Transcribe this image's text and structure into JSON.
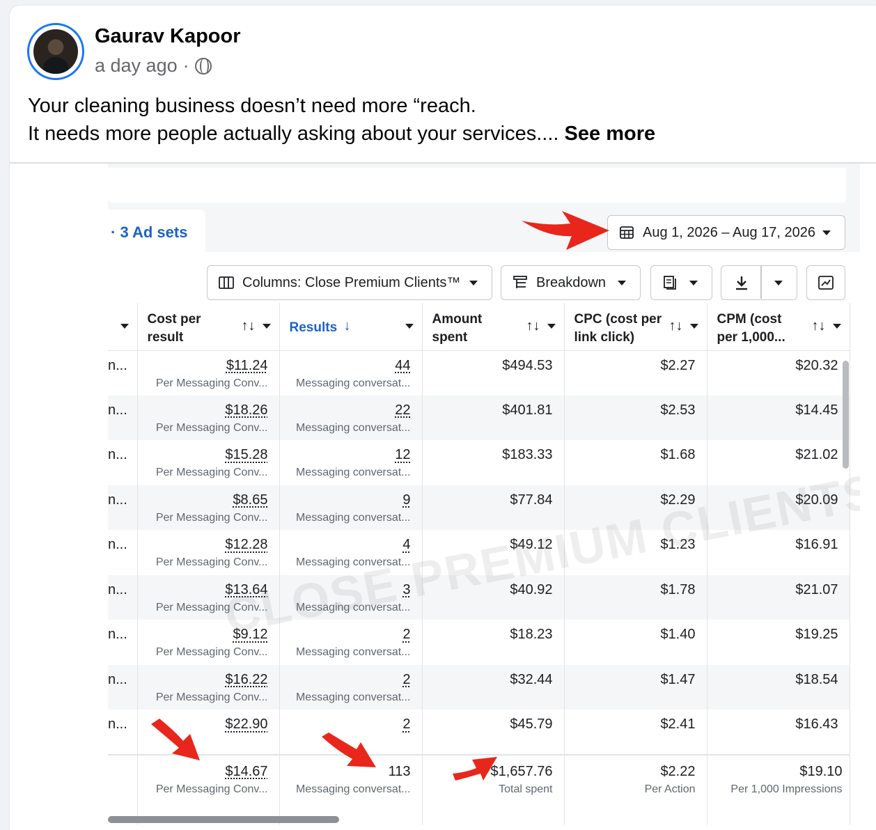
{
  "post": {
    "author": "Gaurav Kapoor",
    "time": "a day ago",
    "separator": "·",
    "line1": "Your cleaning business doesn’t need more “reach.",
    "line2": "It needs more people actually asking about your services....",
    "see_more": "See more"
  },
  "screenshot": {
    "tab_label": "· 3 Ad sets",
    "date_range": "Aug 1, 2026 – Aug 17, 2026",
    "columns_label": "Columns: Close Premium Clients™",
    "breakdown_label": "Breakdown",
    "watermark": "CLOSE PREMIUM CLIENTS",
    "headers": {
      "cost_per_result": "Cost per result",
      "results": "Results",
      "amount_spent": "Amount spent",
      "cpc": "CPC (cost per link click)",
      "cpm": "CPM (cost per 1,000..."
    },
    "sort_icon": "↑↓",
    "results_sort_icon": "↓",
    "lead_text": "n...",
    "cost_sub": "Per Messaging Conv...",
    "results_sub": "Messaging conversat...",
    "rows": [
      {
        "cost": "$11.24",
        "results": "44",
        "amount": "$494.53",
        "cpc": "$2.27",
        "cpm": "$20.32"
      },
      {
        "cost": "$18.26",
        "results": "22",
        "amount": "$401.81",
        "cpc": "$2.53",
        "cpm": "$14.45"
      },
      {
        "cost": "$15.28",
        "results": "12",
        "amount": "$183.33",
        "cpc": "$1.68",
        "cpm": "$21.02"
      },
      {
        "cost": "$8.65",
        "results": "9",
        "amount": "$77.84",
        "cpc": "$2.29",
        "cpm": "$20.09"
      },
      {
        "cost": "$12.28",
        "results": "4",
        "amount": "$49.12",
        "cpc": "$1.23",
        "cpm": "$16.91"
      },
      {
        "cost": "$13.64",
        "results": "3",
        "amount": "$40.92",
        "cpc": "$1.78",
        "cpm": "$21.07"
      },
      {
        "cost": "$9.12",
        "results": "2",
        "amount": "$18.23",
        "cpc": "$1.40",
        "cpm": "$19.25"
      },
      {
        "cost": "$16.22",
        "results": "2",
        "amount": "$32.44",
        "cpc": "$1.47",
        "cpm": "$18.54"
      },
      {
        "cost": "$22.90",
        "results": "2",
        "amount": "$45.79",
        "cpc": "$2.41",
        "cpm": "$16.43"
      }
    ],
    "totals": {
      "cost": "$14.67",
      "cost_sub": "Per Messaging Conv...",
      "results": "113",
      "results_sub": "Messaging conversat...",
      "amount": "$1,657.76",
      "amount_sub": "Total spent",
      "cpc": "$2.22",
      "cpc_sub": "Per Action",
      "cpm": "$19.10",
      "cpm_sub": "Per 1,000 Impressions"
    }
  }
}
